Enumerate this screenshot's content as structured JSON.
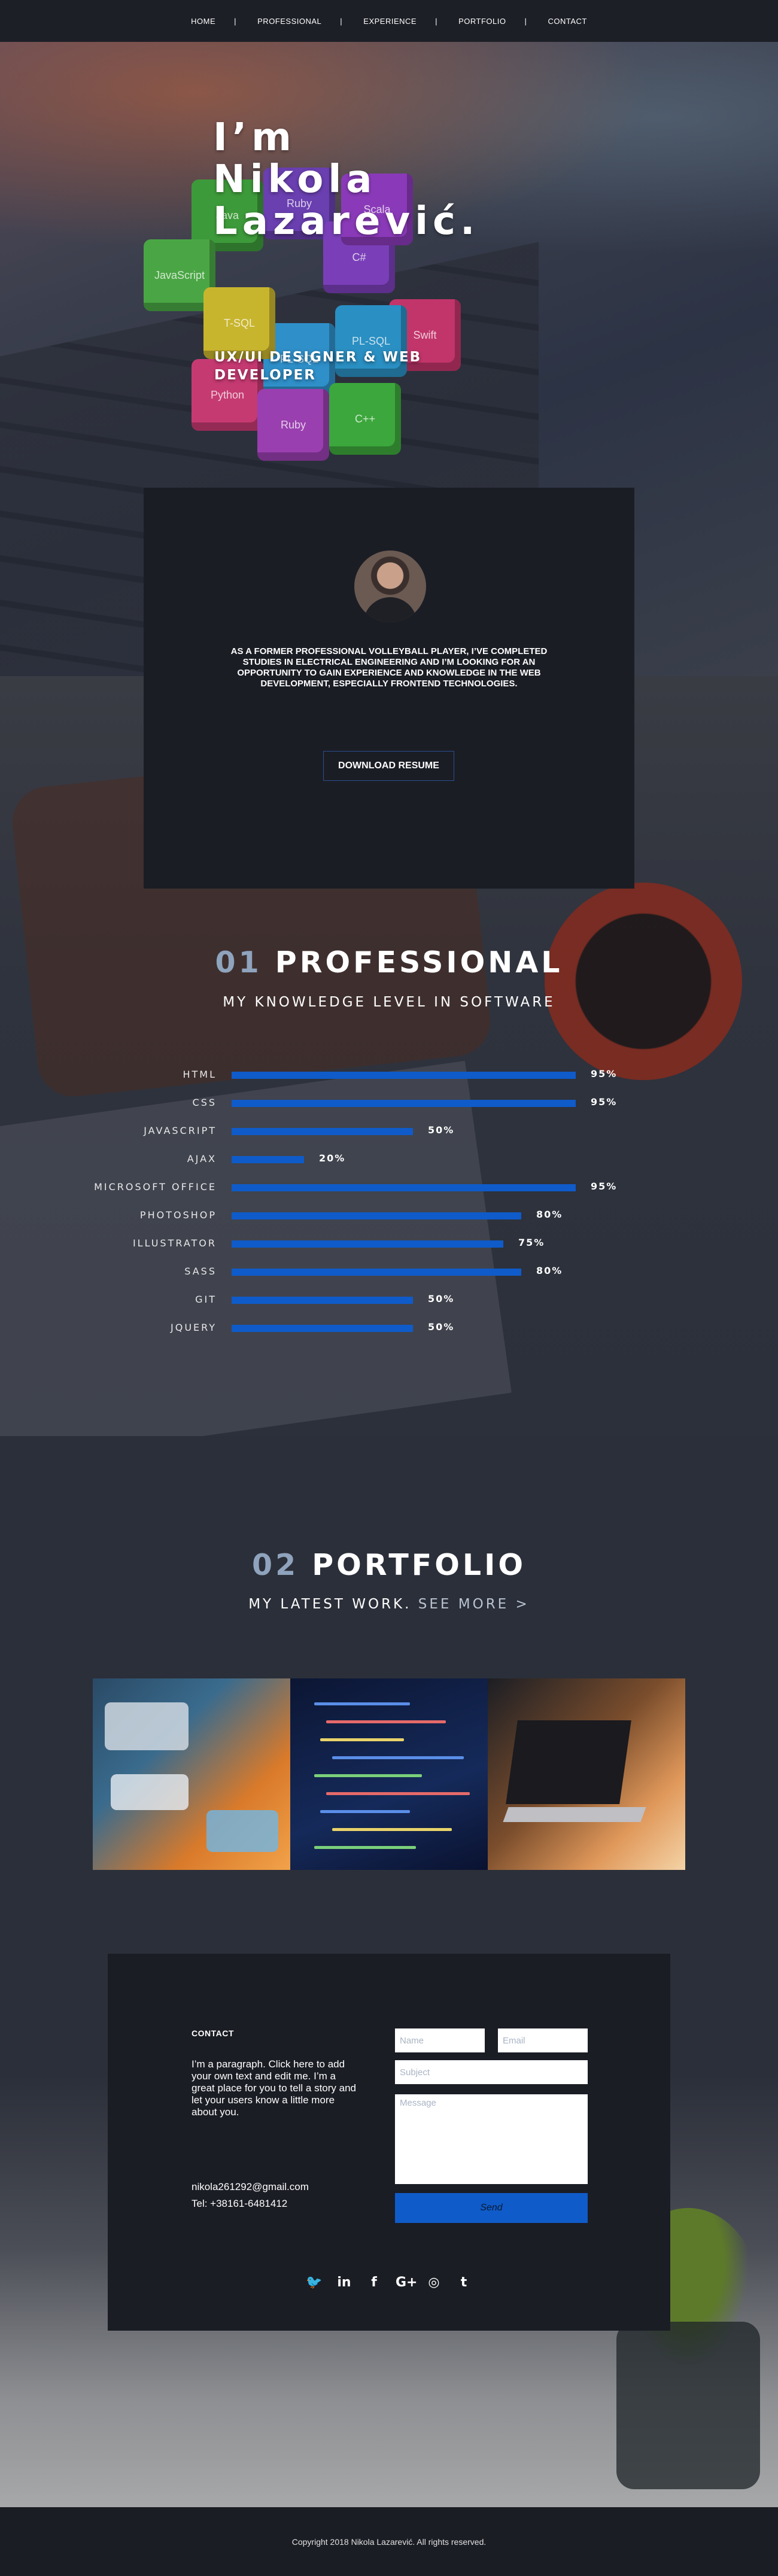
{
  "nav": {
    "items": [
      "HOME",
      "PROFESSIONAL",
      "EXPERIENCE",
      "PORTFOLIO",
      "CONTACT"
    ]
  },
  "hero": {
    "title_line1": "I’m",
    "title_line2": "Nikola",
    "title_line3": "Lazarević.",
    "subtitle": "UX/UI DESIGNER & WEB DEVELOPER",
    "cubes": [
      "Ruby",
      "Java",
      "JavaScript",
      "C#",
      "Swift",
      "PL-SQL",
      "Python",
      "T-SQL",
      "Ruby",
      "Scala",
      "C++",
      "PL-SQL"
    ]
  },
  "about": {
    "text": "AS A FORMER PROFESSIONAL VOLLEYBALL PLAYER, I’VE COMPLETED  STUDIES IN ELECTRICAL ENGINEERING AND I’M LOOKING FOR AN OPPORTUNITY TO GAIN EXPERIENCE AND KNOWLEDGE IN THE WEB DEVELOPMENT,  ESPECIALLY FRONTEND TECHNOLOGIES.",
    "resume_button": "DOWNLOAD RESUME"
  },
  "professional": {
    "number": "01",
    "title": "PROFESSIONAL",
    "subtitle": "MY KNOWLEDGE LEVEL IN SOFTWARE",
    "bar_color": "#0f5bc9",
    "skills": [
      {
        "label": "HTML",
        "value": 95,
        "pct": "95%"
      },
      {
        "label": "CSS",
        "value": 95,
        "pct": "95%"
      },
      {
        "label": "JAVASCRIPT",
        "value": 50,
        "pct": "50%"
      },
      {
        "label": "AJAX",
        "value": 20,
        "pct": "20%"
      },
      {
        "label": "MICROSOFT OFFICE",
        "value": 95,
        "pct": "95%"
      },
      {
        "label": "PHOTOSHOP",
        "value": 80,
        "pct": "80%"
      },
      {
        "label": "ILLUSTRATOR",
        "value": 75,
        "pct": "75%"
      },
      {
        "label": "SASS",
        "value": 80,
        "pct": "80%"
      },
      {
        "label": "GIT",
        "value": 50,
        "pct": "50%"
      },
      {
        "label": "JQUERY",
        "value": 50,
        "pct": "50%"
      }
    ]
  },
  "portfolio": {
    "number": "02",
    "title": "PORTFOLIO",
    "subtitle": "MY LATEST WORK.",
    "see_more": "SEE MORE >"
  },
  "contact": {
    "heading": "CONTACT",
    "paragraph": "I’m a paragraph. Click here to add your own text and edit me. I’m a great place for you to tell a story and let your users know a little more about you.",
    "email": "nikola261292@gmail.com",
    "tel": "Tel: +38161-6481412",
    "name_placeholder": "Name",
    "email_placeholder": "Email",
    "subject_placeholder": "Subject",
    "message_placeholder": "Message",
    "send_label": "Send",
    "socials": [
      {
        "icon": "twitter-icon",
        "glyph": "🐦"
      },
      {
        "icon": "linkedin-icon",
        "glyph": "in"
      },
      {
        "icon": "facebook-icon",
        "glyph": "f"
      },
      {
        "icon": "google-plus-icon",
        "glyph": "G+"
      },
      {
        "icon": "instagram-icon",
        "glyph": "◎"
      },
      {
        "icon": "tumblr-icon",
        "glyph": "t"
      }
    ]
  },
  "footer": {
    "copyright": "Copyright 2018 Nikola Lazarević. All rights reserved."
  }
}
